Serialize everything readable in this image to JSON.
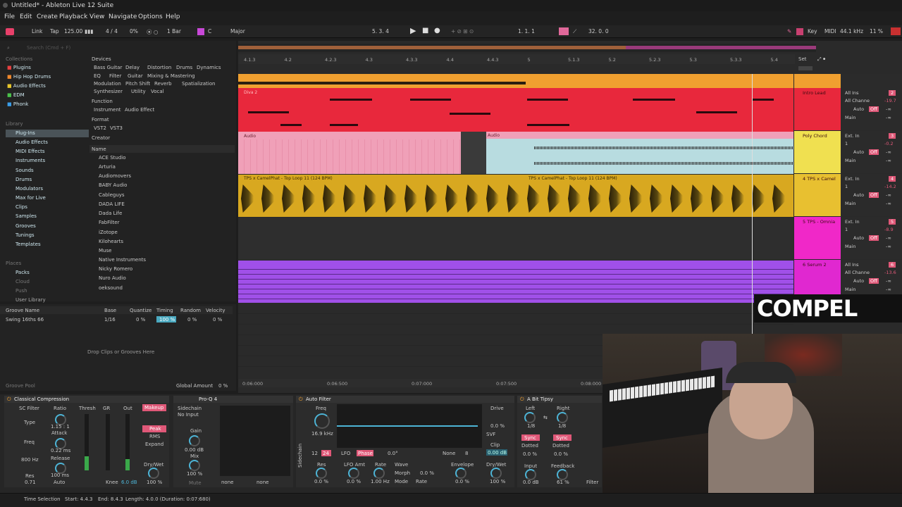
{
  "window": {
    "title": "Untitled* - Ableton Live 12 Suite"
  },
  "menu": [
    "File",
    "Edit",
    "Create",
    "Playback",
    "View",
    "Navigate",
    "Options",
    "Help"
  ],
  "transport": {
    "link": "Link",
    "tap": "Tap",
    "tempo": "125.00",
    "sig": "4 / 4",
    "cpu_pct": "0%",
    "quant": "1 Bar",
    "key": "C",
    "scale": "Major",
    "position": "5. 3. 4",
    "loop_start": "1. 1. 1",
    "loop_len": "32. 0. 0",
    "key_btn": "Key",
    "midi": "MIDI",
    "sample_rate": "44.1 kHz",
    "cpu": "11 %"
  },
  "browser": {
    "search_placeholder": "Search (Cmd + F)",
    "collections_label": "Collections",
    "collections": [
      {
        "label": "Plugins",
        "color": "#e84040"
      },
      {
        "label": "Hip Hop Drums",
        "color": "#f0892c"
      },
      {
        "label": "Audio Effects",
        "color": "#e8c72c"
      },
      {
        "label": "EDM",
        "color": "#4ac24a"
      },
      {
        "label": "Phonk",
        "color": "#3a9de8"
      }
    ],
    "library_label": "Library",
    "library": [
      "Plug-Ins",
      "Audio Effects",
      "MIDI Effects",
      "Instruments",
      "Sounds",
      "Drums",
      "Modulators",
      "Max for Live",
      "Clips",
      "Samples",
      "Grooves",
      "Tunings",
      "Templates"
    ],
    "places_label": "Places",
    "places": [
      "Packs",
      "Cloud",
      "Push",
      "User Library"
    ],
    "filters": {
      "devices": "Devices",
      "dev_tags": [
        "Bass Guitar",
        "Delay",
        "Distortion",
        "Drums",
        "Dynamics",
        "EQ",
        "Filter",
        "Guitar",
        "Mixing & Mastering",
        "Modulation",
        "Pitch Shift",
        "Reverb",
        "Spatialization",
        "Synthesizer",
        "Utility",
        "Vocal"
      ],
      "function": "Function",
      "func_tags": [
        "Instrument",
        "Audio Effect"
      ],
      "format": "Format",
      "format_tags": [
        "VST2",
        "VST3"
      ],
      "creator": "Creator"
    },
    "name_header": "Name",
    "items": [
      "ACE Studio",
      "Arturia",
      "Audiomovers",
      "BABY Audio",
      "Cableguys",
      "DADA LIFE",
      "Dada Life",
      "FabFilter",
      "iZotope",
      "Kilohearts",
      "Muse",
      "Native Instruments",
      "Nicky Romero",
      "Nuro Audio",
      "oeksound"
    ]
  },
  "groove": {
    "headers": [
      "Groove Name",
      "Base",
      "Quantize",
      "Timing",
      "Random",
      "Velocity"
    ],
    "row": {
      "name": "Swing 16ths 66",
      "base": "1/16",
      "quantize": "0 %",
      "timing": "100 %",
      "random": "0 %",
      "velocity": "0 %"
    },
    "drop": "Drop Clips or Grooves Here",
    "pool": "Groove Pool",
    "global": "Global Amount",
    "global_val": "0 %"
  },
  "ruler": [
    "4.1.3",
    "4.2",
    "4.2.3",
    "4.3",
    "4.3.3",
    "4.4",
    "4.4.3",
    "5",
    "5.1.3",
    "5.2",
    "5.2.3",
    "5.3",
    "5.3.3",
    "5.4"
  ],
  "time_ruler": [
    "0:06:000",
    "0:06:500",
    "0:07:000",
    "0:07:500",
    "0:08:000"
  ],
  "set_label": "Set",
  "clips": {
    "diva": "Diva 2",
    "audio1": "Audio",
    "audio2": "Audio",
    "loop1": "TPS x CamelPhat - Top Loop 11 (124 BPM)",
    "loop2": "TPS x CamelPhat - Top Loop 11 (124 BPM)"
  },
  "tracks": [
    {
      "name": "Intro Lead",
      "color": "#e8283c",
      "input": "All Ins",
      "ch": "All Channe",
      "mon": "Auto",
      "out": "Main",
      "num": "2",
      "vol": "-19.7"
    },
    {
      "name": "Poly Chord",
      "color": "#f0e050",
      "input": "Ext. In",
      "ch": "1",
      "mon": "Auto",
      "out": "Main",
      "num": "3",
      "vol": "-0.2"
    },
    {
      "name": "4 TPS x Camel",
      "color": "#e8c030",
      "input": "Ext. In",
      "ch": "1",
      "mon": "Auto",
      "out": "Main",
      "num": "4",
      "vol": "-14.2"
    },
    {
      "name": "5 TPS - Omnia",
      "color": "#f028c8",
      "input": "Ext. In",
      "ch": "1",
      "mon": "Auto",
      "out": "Main",
      "num": "5",
      "vol": "-8.9"
    },
    {
      "name": "6 Serum 2",
      "color": "#e028d0",
      "input": "All Ins",
      "ch": "All Channe",
      "mon": "Auto",
      "out": "Main",
      "num": "6",
      "vol": "-13.6"
    }
  ],
  "mix_off": "Off",
  "mix_inf": "-∞",
  "watermark": "COMPEL",
  "devices": {
    "comp": {
      "title": "Classical Compression",
      "sc": "SC Filter",
      "type": "Type",
      "freq": "Freq",
      "freq_val": "800 Hz",
      "res": "Res",
      "res_val": "0.71",
      "ratio": "Ratio",
      "ratio_val": "1.15 : 1",
      "attack": "Attack",
      "attack_val": "0.22 ms",
      "release": "Release",
      "release_val": "100 ms",
      "auto": "Auto",
      "thresh": "Thresh",
      "gr": "GR",
      "out": "Out",
      "knee": "Knee",
      "knee_val": "6.0 dB",
      "makeup": "Makeup",
      "peak": "Peak",
      "rms": "RMS",
      "expand": "Expand",
      "drywet": "Dry/Wet",
      "drywet_val": "100 %"
    },
    "proq": {
      "title": "Pro-Q 4",
      "sidechain": "Sidechain",
      "no_input": "No Input",
      "gain": "Gain",
      "gain_val": "0.00 dB",
      "mix": "Mix",
      "mix_val": "100 %",
      "mute": "Mute",
      "none1": "none",
      "none2": "none"
    },
    "autofilter": {
      "title": "Auto Filter",
      "freq": "Freq",
      "freq_val": "16.9 kHz",
      "drive": "Drive",
      "drive_val": "0.0 %",
      "clip": "Clip",
      "clip_val": "0.00 dB",
      "lfo": "LFO",
      "phase": "Phase",
      "deg": "0.0°",
      "none": "None",
      "res": "Res",
      "res_val": "0.0 %",
      "lfo_amt": "LFO Amt",
      "lfo_amt_val": "0.0 %",
      "rate": "Rate",
      "rate_val": "1.00 Hz",
      "wave": "Wave",
      "morph": "Morph",
      "morph_val": "0.0 %",
      "mode": "Mode",
      "mode_val": "Rate",
      "envelope": "Envelope",
      "env_val": "0.0 %",
      "drywet": "Dry/Wet",
      "drywet_val": "100 %",
      "a12": "12",
      "a24": "24",
      "a8": "8",
      "sidechain": "Sidechain",
      "svf": "SVF"
    },
    "delay": {
      "title": "A Bit Tipsy",
      "left": "Left",
      "right": "Right",
      "l_val": "1/8",
      "r_val": "1/8",
      "sync": "Sync",
      "dotted": "Dotted",
      "pct1": "0.0 %",
      "pct2": "0.0 %",
      "input": "Input",
      "input_val": "0.0 dB",
      "feedback": "Feedback",
      "fb_val": "61 %",
      "filter": "Filter"
    }
  },
  "status": {
    "label": "Time Selection",
    "start": "Start: 4.4.3",
    "end": "End: 8.4.3",
    "length": "Length: 4.0.0 (Duration: 0:07:680)"
  }
}
